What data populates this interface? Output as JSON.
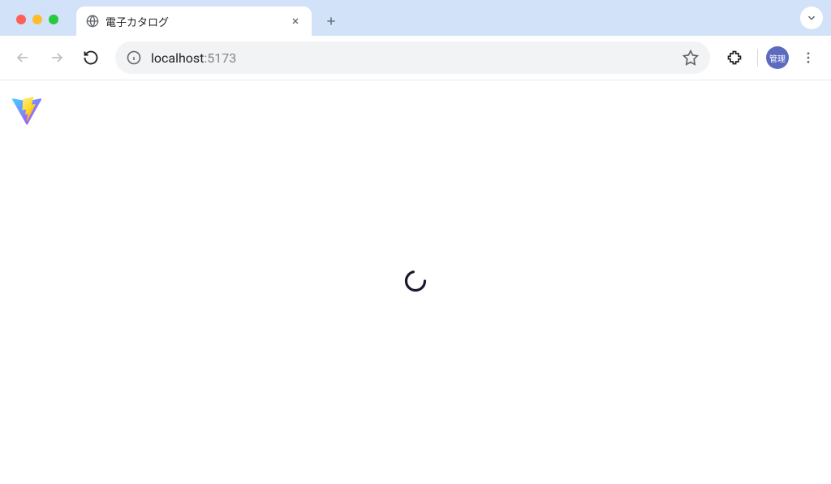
{
  "tab": {
    "title": "電子カタログ"
  },
  "address": {
    "host": "localhost",
    "port": ":5173"
  },
  "profile": {
    "label": "管理"
  }
}
